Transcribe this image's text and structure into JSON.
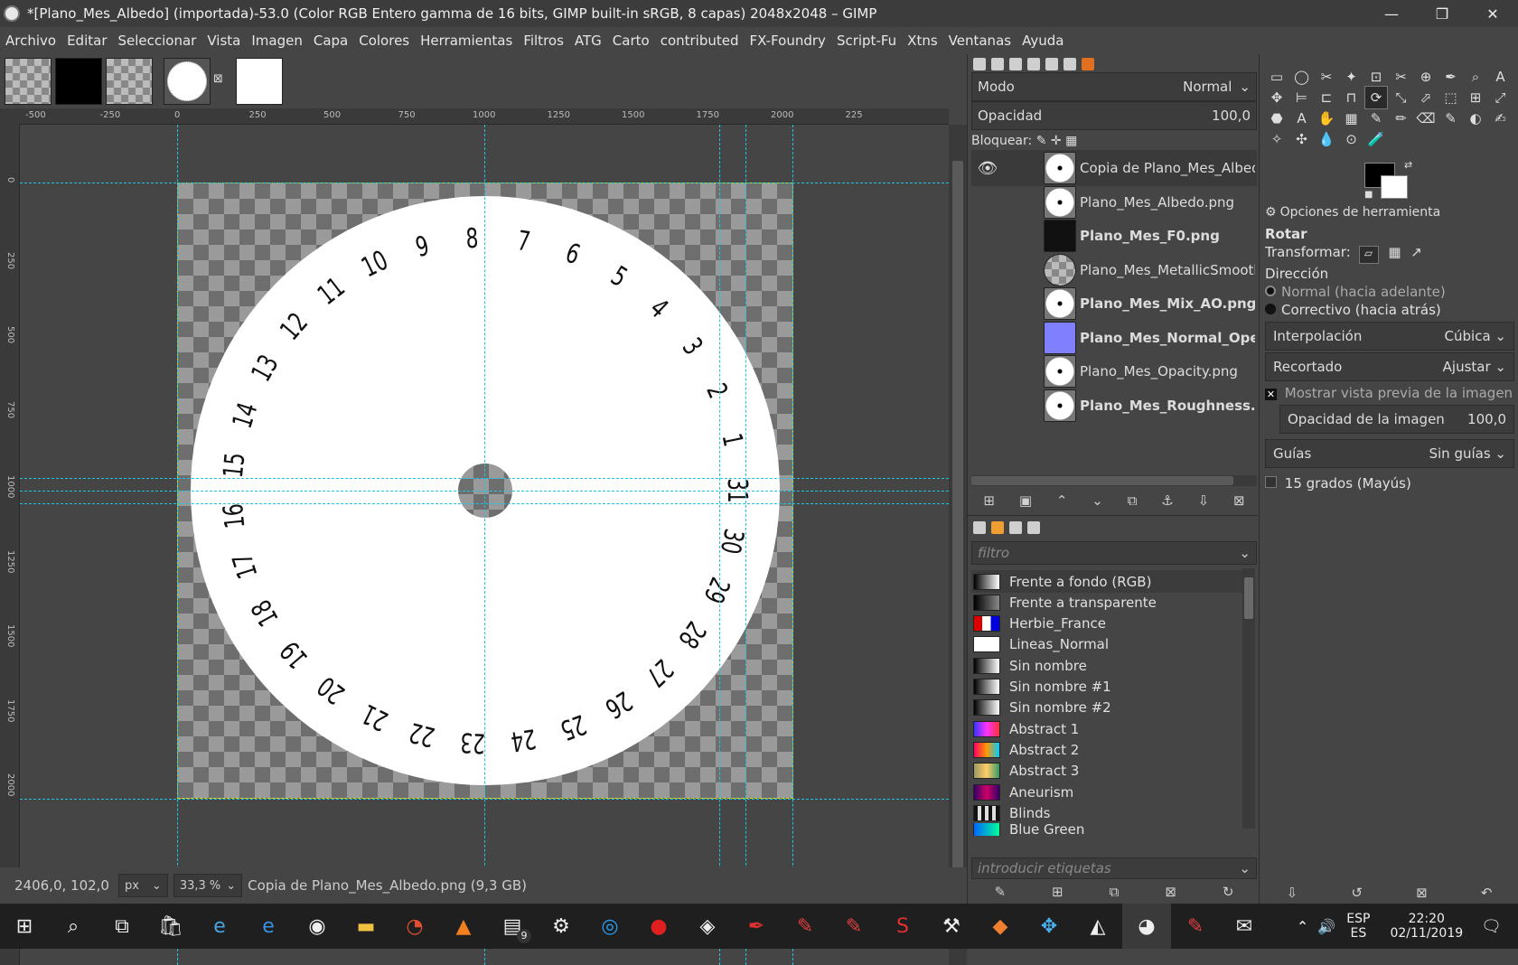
{
  "window": {
    "title": "*[Plano_Mes_Albedo] (importada)-53.0 (Color RGB Entero gamma de 16 bits, GIMP built-in sRGB, 8 capas) 2048x2048 – GIMP",
    "minimize": "—",
    "maximize": "❐",
    "close": "✕"
  },
  "menu": [
    "Archivo",
    "Editar",
    "Seleccionar",
    "Vista",
    "Imagen",
    "Capa",
    "Colores",
    "Herramientas",
    "Filtros",
    "ATG",
    "Carto",
    "contributed",
    "FX-Foundry",
    "Script-Fu",
    "Xtns",
    "Ventanas",
    "Ayuda"
  ],
  "image_tabs": [
    {
      "name": "tab-transparent"
    },
    {
      "name": "tab-black"
    },
    {
      "name": "tab-metallic"
    },
    {
      "name": "tab-dial"
    },
    {
      "name": "tab-white"
    }
  ],
  "ruler": {
    "h_ticks": [
      "-500",
      "-250",
      "0",
      "250",
      "500",
      "750",
      "1000",
      "1250",
      "1500",
      "1750",
      "2000",
      "225"
    ],
    "v_ticks": [
      "0",
      "250",
      "500",
      "750",
      "1000",
      "1250",
      "1500",
      "1750",
      "2000"
    ]
  },
  "dial_numbers": [
    "1",
    "2",
    "3",
    "4",
    "5",
    "6",
    "7",
    "8",
    "9",
    "10",
    "11",
    "12",
    "13",
    "14",
    "15",
    "16",
    "17",
    "18",
    "19",
    "20",
    "21",
    "22",
    "23",
    "24",
    "25",
    "26",
    "27",
    "28",
    "29",
    "30",
    "31"
  ],
  "status": {
    "coords": "2406,0, 102,0",
    "unit": "px",
    "zoom": "33,3 %",
    "info": "Copia de Plano_Mes_Albedo.png (9,3 GB)"
  },
  "layers_panel": {
    "mode_label": "Modo",
    "mode_value": "Normal",
    "opacity_label": "Opacidad",
    "opacity_value": "100,0",
    "lock_label": "Bloquear:",
    "layers": [
      {
        "name": "Copia de Plano_Mes_Albedo.png",
        "bold": false,
        "visible": true,
        "thumb": "dial"
      },
      {
        "name": "Plano_Mes_Albedo.png",
        "bold": false,
        "visible": false,
        "thumb": "dial"
      },
      {
        "name": "Plano_Mes_F0.png",
        "bold": true,
        "visible": false,
        "thumb": "black"
      },
      {
        "name": "Plano_Mes_MetallicSmoothness.p",
        "bold": false,
        "visible": false,
        "thumb": "checker"
      },
      {
        "name": "Plano_Mes_Mix_AO.png",
        "bold": true,
        "visible": false,
        "thumb": "dial"
      },
      {
        "name": "Plano_Mes_Normal_OpenGL.",
        "bold": true,
        "visible": false,
        "thumb": "normal"
      },
      {
        "name": "Plano_Mes_Opacity.png",
        "bold": false,
        "visible": false,
        "thumb": "dial"
      },
      {
        "name": "Plano_Mes_Roughness.png",
        "bold": true,
        "visible": false,
        "thumb": "dial"
      }
    ]
  },
  "gradients_panel": {
    "filter_placeholder": "filtro",
    "tags_placeholder": "introducir etiquetas",
    "items": [
      {
        "name": "Frente a fondo (RGB)",
        "swatch": "linear-gradient(90deg,#000,#fff)"
      },
      {
        "name": "Frente a transparente",
        "swatch": "linear-gradient(90deg,#000,#888)"
      },
      {
        "name": "Herbie_France",
        "swatch": "linear-gradient(90deg,#d00 0 33%,#fff 33% 66%,#00d 66%)"
      },
      {
        "name": "Lineas_Normal",
        "swatch": "linear-gradient(90deg,#fff,#fff)"
      },
      {
        "name": "Sin nombre",
        "swatch": "linear-gradient(90deg,#000,#fff)"
      },
      {
        "name": "Sin nombre #1",
        "swatch": "linear-gradient(90deg,#000,#fff)"
      },
      {
        "name": "Sin nombre #2",
        "swatch": "linear-gradient(90deg,#000,#fff)"
      },
      {
        "name": "Abstract 1",
        "swatch": "linear-gradient(90deg,#33f,#f3f,#f33)"
      },
      {
        "name": "Abstract 2",
        "swatch": "linear-gradient(90deg,#f06,#f90,#0cf)"
      },
      {
        "name": "Abstract 3",
        "swatch": "linear-gradient(90deg,#996,#fc6,#396)"
      },
      {
        "name": "Aneurism",
        "swatch": "linear-gradient(90deg,#306,#c06,#306)"
      },
      {
        "name": "Blinds",
        "swatch": "repeating-linear-gradient(90deg,#111 0 4px,#ddd 4px 8px)"
      },
      {
        "name": "Blue Green",
        "swatch": "linear-gradient(90deg,#06f,#0f9)"
      }
    ]
  },
  "tool_options": {
    "header": "Opciones de herramienta",
    "tool_name": "Rotar",
    "transform_label": "Transformar:",
    "direction_label": "Dirección",
    "dir_normal": "Normal (hacia adelante)",
    "dir_corrective": "Correctivo (hacia atrás)",
    "interp_label": "Interpolación",
    "interp_value": "Cúbica",
    "clip_label": "Recortado",
    "clip_value": "Ajustar",
    "preview_label": "Mostrar vista previa de la imagen",
    "img_opacity_label": "Opacidad de la imagen",
    "img_opacity_value": "100,0",
    "guides_label": "Guías",
    "guides_value": "Sin guías",
    "deg15_label": "15 grados (Mayús)"
  },
  "taskbar": {
    "lang_top": "ESP",
    "lang_bottom": "ES",
    "time": "22:20",
    "date": "02/11/2019",
    "badge": "9"
  }
}
